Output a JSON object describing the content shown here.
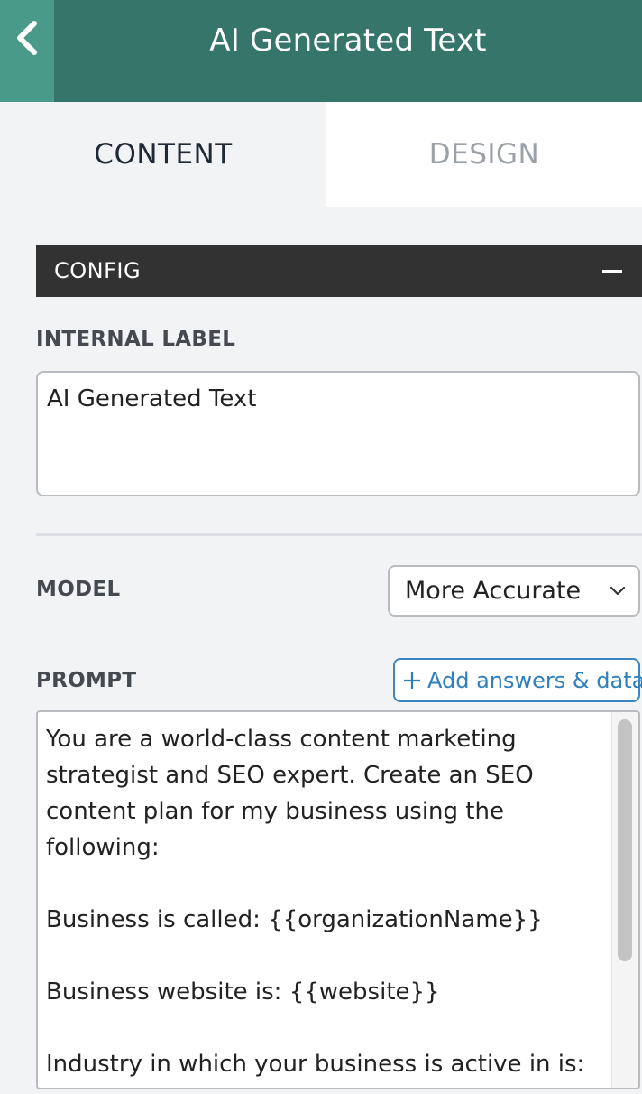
{
  "header": {
    "title": "AI Generated Text",
    "back_icon": "chevron-left-icon"
  },
  "tabs": [
    {
      "label": "CONTENT",
      "active": true
    },
    {
      "label": "DESIGN",
      "active": false
    }
  ],
  "config": {
    "title": "CONFIG",
    "collapse_icon": "minus-icon"
  },
  "internal_label": {
    "label": "INTERNAL LABEL",
    "value": "AI Generated Text"
  },
  "model": {
    "label": "MODEL",
    "selected": "More Accurate"
  },
  "prompt": {
    "label": "PROMPT",
    "add_button_label": "Add answers & data",
    "value": "You are a world-class content marketing strategist and SEO expert. Create an SEO content plan for my business using the following:\n\nBusiness is called: {{organizationName}}\n\nBusiness website is: {{website}}\n\nIndustry in which your business is active in is:"
  },
  "colors": {
    "header_bg": "#36766a",
    "back_bg": "#4a9a8a",
    "config_bg": "#323232",
    "accent_blue": "#2f7fbf"
  }
}
